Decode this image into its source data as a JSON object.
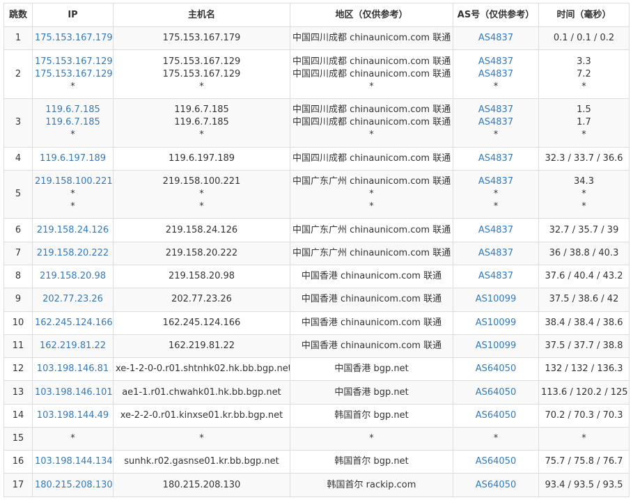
{
  "columns": {
    "hop": "跳数",
    "ip": "IP",
    "host": "主机名",
    "region": "地区（仅供参考）",
    "asn": "AS号（仅供参考）",
    "time": "时间（毫秒）"
  },
  "rows": [
    {
      "hop": "1",
      "ip": [
        "175.153.167.179"
      ],
      "host": [
        "175.153.167.179"
      ],
      "region": [
        "中国四川成都 chinaunicom.com 联通"
      ],
      "asn": [
        "AS4837"
      ],
      "time": [
        "0.1 / 0.1 / 0.2"
      ]
    },
    {
      "hop": "2",
      "ip": [
        "175.153.167.129",
        "175.153.167.129",
        "*"
      ],
      "host": [
        "175.153.167.129",
        "175.153.167.129",
        "*"
      ],
      "region": [
        "中国四川成都 chinaunicom.com 联通",
        "中国四川成都 chinaunicom.com 联通",
        "*"
      ],
      "asn": [
        "AS4837",
        "AS4837",
        "*"
      ],
      "time": [
        "3.3",
        "7.2",
        "*"
      ]
    },
    {
      "hop": "3",
      "ip": [
        "119.6.7.185",
        "119.6.7.185",
        "*"
      ],
      "host": [
        "119.6.7.185",
        "119.6.7.185",
        "*"
      ],
      "region": [
        "中国四川成都 chinaunicom.com 联通",
        "中国四川成都 chinaunicom.com 联通",
        "*"
      ],
      "asn": [
        "AS4837",
        "AS4837",
        "*"
      ],
      "time": [
        "1.5",
        "1.7",
        "*"
      ]
    },
    {
      "hop": "4",
      "ip": [
        "119.6.197.189"
      ],
      "host": [
        "119.6.197.189"
      ],
      "region": [
        "中国四川成都 chinaunicom.com 联通"
      ],
      "asn": [
        "AS4837"
      ],
      "time": [
        "32.3 / 33.7 / 36.6"
      ]
    },
    {
      "hop": "5",
      "ip": [
        "219.158.100.221",
        "*",
        "*"
      ],
      "host": [
        "219.158.100.221",
        "*",
        "*"
      ],
      "region": [
        "中国广东广州 chinaunicom.com 联通",
        "*",
        "*"
      ],
      "asn": [
        "AS4837",
        "*",
        "*"
      ],
      "time": [
        "34.3",
        "*",
        "*"
      ]
    },
    {
      "hop": "6",
      "ip": [
        "219.158.24.126"
      ],
      "host": [
        "219.158.24.126"
      ],
      "region": [
        "中国广东广州 chinaunicom.com 联通"
      ],
      "asn": [
        "AS4837"
      ],
      "time": [
        "32.7 / 35.7 / 39"
      ]
    },
    {
      "hop": "7",
      "ip": [
        "219.158.20.222"
      ],
      "host": [
        "219.158.20.222"
      ],
      "region": [
        "中国广东广州 chinaunicom.com 联通"
      ],
      "asn": [
        "AS4837"
      ],
      "time": [
        "36 / 38.8 / 40.3"
      ]
    },
    {
      "hop": "8",
      "ip": [
        "219.158.20.98"
      ],
      "host": [
        "219.158.20.98"
      ],
      "region": [
        "中国香港 chinaunicom.com 联通"
      ],
      "asn": [
        "AS4837"
      ],
      "time": [
        "37.6 / 40.4 / 43.2"
      ]
    },
    {
      "hop": "9",
      "ip": [
        "202.77.23.26"
      ],
      "host": [
        "202.77.23.26"
      ],
      "region": [
        "中国香港 chinaunicom.com 联通"
      ],
      "asn": [
        "AS10099"
      ],
      "time": [
        "37.5 / 38.6 / 42"
      ]
    },
    {
      "hop": "10",
      "ip": [
        "162.245.124.166"
      ],
      "host": [
        "162.245.124.166"
      ],
      "region": [
        "中国香港 chinaunicom.com 联通"
      ],
      "asn": [
        "AS10099"
      ],
      "time": [
        "38.4 / 38.4 / 38.6"
      ]
    },
    {
      "hop": "11",
      "ip": [
        "162.219.81.22"
      ],
      "host": [
        "162.219.81.22"
      ],
      "region": [
        "中国香港 chinaunicom.com 联通"
      ],
      "asn": [
        "AS10099"
      ],
      "time": [
        "37.5 / 37.7 / 38.8"
      ]
    },
    {
      "hop": "12",
      "ip": [
        "103.198.146.81"
      ],
      "host": [
        "xe-1-2-0-0.r01.shtnhk02.hk.bb.bgp.net"
      ],
      "region": [
        "中国香港 bgp.net"
      ],
      "asn": [
        "AS64050"
      ],
      "time": [
        "132 / 132 / 136.3"
      ]
    },
    {
      "hop": "13",
      "ip": [
        "103.198.146.101"
      ],
      "host": [
        "ae1-1.r01.chwahk01.hk.bb.bgp.net"
      ],
      "region": [
        "中国香港 bgp.net"
      ],
      "asn": [
        "AS64050"
      ],
      "time": [
        "113.6 / 120.2 / 125"
      ]
    },
    {
      "hop": "14",
      "ip": [
        "103.198.144.49"
      ],
      "host": [
        "xe-2-2-0.r01.kinxse01.kr.bb.bgp.net"
      ],
      "region": [
        "韩国首尔 bgp.net"
      ],
      "asn": [
        "AS64050"
      ],
      "time": [
        "70.2 / 70.3 / 70.3"
      ]
    },
    {
      "hop": "15",
      "ip": [
        "*"
      ],
      "host": [
        "*"
      ],
      "region": [
        "*"
      ],
      "asn": [
        "*"
      ],
      "time": [
        "*"
      ]
    },
    {
      "hop": "16",
      "ip": [
        "103.198.144.134"
      ],
      "host": [
        "sunhk.r02.gasnse01.kr.bb.bgp.net"
      ],
      "region": [
        "韩国首尔 bgp.net"
      ],
      "asn": [
        "AS64050"
      ],
      "time": [
        "75.7 / 75.8 / 76.7"
      ]
    },
    {
      "hop": "17",
      "ip": [
        "180.215.208.130"
      ],
      "host": [
        "180.215.208.130"
      ],
      "region": [
        "韩国首尔 rackip.com"
      ],
      "asn": [
        "AS64050"
      ],
      "time": [
        "93.4 / 93.5 / 93.5"
      ]
    }
  ]
}
